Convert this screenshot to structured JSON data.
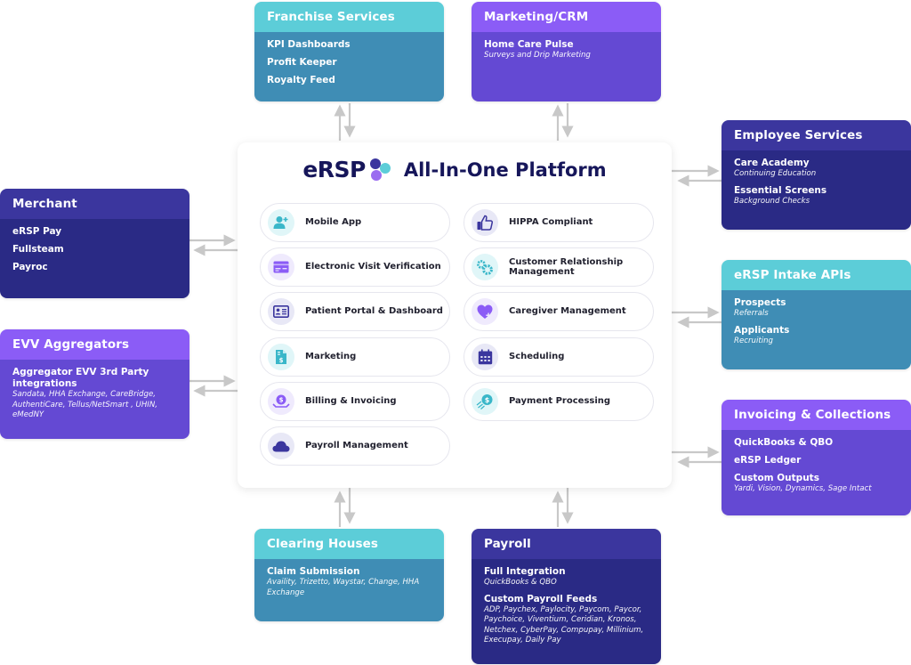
{
  "platform": {
    "logo": "eRSP",
    "title": "All-In-One Platform",
    "logo_colors": [
      "#3b369e",
      "#5ccdd8",
      "#9a6cf0"
    ],
    "features_left": [
      {
        "label": "Mobile App",
        "icon": "add-user-icon"
      },
      {
        "label": "Electronic Visit Verification",
        "icon": "card-icon"
      },
      {
        "label": "Patient Portal & Dashboard",
        "icon": "id-card-icon"
      },
      {
        "label": "Marketing",
        "icon": "invoice-dollar-icon"
      },
      {
        "label": "Billing & Invoicing",
        "icon": "coin-hand-icon"
      },
      {
        "label": "Payroll Management",
        "icon": "cloud-icon"
      }
    ],
    "features_right": [
      {
        "label": "HIPPA Compliant",
        "icon": "thumbs-up-icon"
      },
      {
        "label": "Customer Relationship Management",
        "icon": "gears-icon"
      },
      {
        "label": "Caregiver Management",
        "icon": "heart-plus-icon"
      },
      {
        "label": "Scheduling",
        "icon": "calendar-icon"
      },
      {
        "label": "Payment Processing",
        "icon": "fast-dollar-icon"
      }
    ]
  },
  "boxes": {
    "franchise": {
      "title": "Franchise Services",
      "items": [
        "KPI Dashboards",
        "Profit Keeper",
        "Royalty Feed"
      ]
    },
    "marketing": {
      "title": "Marketing/CRM",
      "groups": [
        {
          "name": "Home Care Pulse",
          "sub": "Surveys and Drip Marketing"
        }
      ]
    },
    "merchant": {
      "title": "Merchant",
      "items": [
        "eRSP Pay",
        "Fullsteam",
        "Payroc"
      ]
    },
    "evv": {
      "title": "EVV Aggregators",
      "groups": [
        {
          "name": "Aggregator EVV 3rd Party integrations",
          "sub": "Sandata, HHA Exchange, CareBridge, AuthentiCare, Tellus/NetSmart , UHIN, eMedNY"
        }
      ]
    },
    "employee": {
      "title": "Employee Services",
      "groups": [
        {
          "name": "Care Academy",
          "sub": "Continuing Education"
        },
        {
          "name": "Essential Screens",
          "sub": "Background Checks"
        }
      ]
    },
    "intake": {
      "title": "eRSP Intake APIs",
      "groups": [
        {
          "name": "Prospects",
          "sub": "Referrals"
        },
        {
          "name": "Applicants",
          "sub": "Recruiting"
        }
      ]
    },
    "invoicing": {
      "title": "Invoicing & Collections",
      "items": [
        "QuickBooks & QBO",
        "eRSP Ledger"
      ],
      "groups": [
        {
          "name": "Custom Outputs",
          "sub": "Yardi, Vision, Dynamics, Sage Intact"
        }
      ]
    },
    "clearing": {
      "title": "Clearing Houses",
      "groups": [
        {
          "name": "Claim Submission",
          "sub": "Availity, Trizetto, Waystar, Change, HHA Exchange"
        }
      ]
    },
    "payroll": {
      "title": "Payroll",
      "groups": [
        {
          "name": "Full Integration",
          "sub": "QuickBooks & QBO"
        },
        {
          "name": "Custom Payroll Feeds",
          "sub": "ADP, Paychex, Paylocity, Paycom, Paycor, Paychoice, Viventium, Ceridian, Kronos, Netchex, CyberPay, Compupay, Millinium, Execupay, Daily Pay"
        }
      ]
    }
  },
  "colors": {
    "teal_header": "#5ccdd8",
    "teal_body": "#3f8db5",
    "violet_header": "#8b5cf6",
    "violet_body": "#6449d3",
    "navy_header": "#3b369e",
    "navy_body": "#2a2a85",
    "arrow": "#c8c8c8",
    "title": "#16165a"
  }
}
